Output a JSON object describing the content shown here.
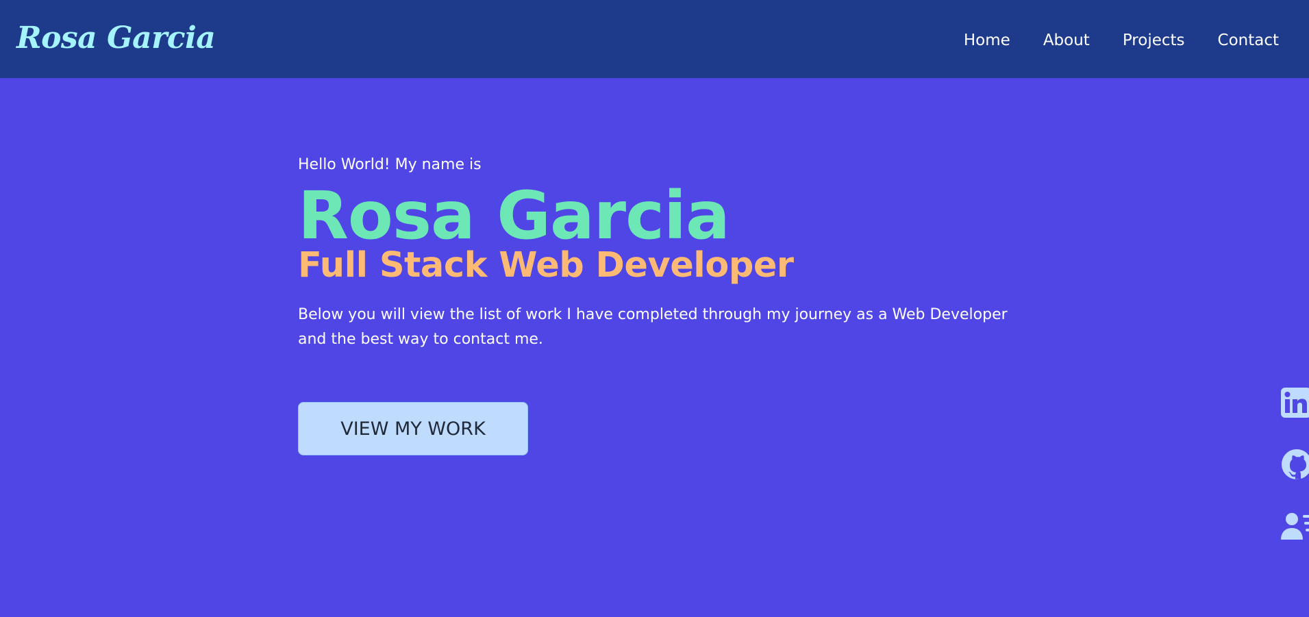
{
  "navbar": {
    "brand": "Rosa Garcia",
    "links": [
      {
        "label": "Home"
      },
      {
        "label": "About"
      },
      {
        "label": "Projects"
      },
      {
        "label": "Contact"
      }
    ]
  },
  "hero": {
    "greeting": "Hello World! My name is",
    "name": "Rosa Garcia",
    "role": "Full Stack Web Developer",
    "description": "Below you will view the list of work I have completed through my journey as a Web Developer and the best way to contact me.",
    "cta_label": "VIEW MY WORK"
  },
  "social": {
    "items": [
      {
        "icon": "linkedin-icon"
      },
      {
        "icon": "github-icon"
      },
      {
        "icon": "resume-icon"
      }
    ]
  },
  "colors": {
    "page_background": "#4f46e5",
    "navbar_background": "#1e3a8a",
    "brand": "#a5f3fc",
    "name": "#6ee7b7",
    "role": "#fdba74",
    "button_background": "#bfdbfe",
    "social_icons": "#bfdbfe"
  }
}
